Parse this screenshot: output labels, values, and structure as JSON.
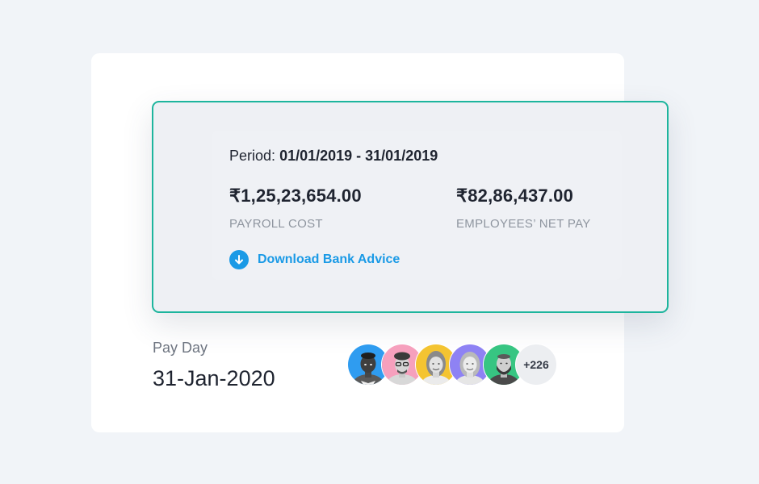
{
  "summary": {
    "period_label": "Period:",
    "period_value": "01/01/2019 - 31/01/2019",
    "payroll_cost": {
      "amount": "₹1,25,23,654.00",
      "label": "PAYROLL COST"
    },
    "net_pay": {
      "amount": "₹82,86,437.00",
      "label": "EMPLOYEES’ NET PAY"
    },
    "download_label": "Download Bank Advice",
    "download_icon": "download-arrow-icon"
  },
  "payday": {
    "label": "Pay Day",
    "date": "31-Jan-2020"
  },
  "employees": {
    "avatars": [
      {
        "name": "employee-avatar-1",
        "bg": "#2f9cf0"
      },
      {
        "name": "employee-avatar-2",
        "bg": "#f6a0bd"
      },
      {
        "name": "employee-avatar-3",
        "bg": "#f4c431"
      },
      {
        "name": "employee-avatar-4",
        "bg": "#8e82f4"
      },
      {
        "name": "employee-avatar-5",
        "bg": "#37c582"
      }
    ],
    "more_count": "+226"
  },
  "colors": {
    "accent_border": "#1db59d",
    "link_blue": "#1a9ae6",
    "page_background": "#f1f4f8"
  }
}
